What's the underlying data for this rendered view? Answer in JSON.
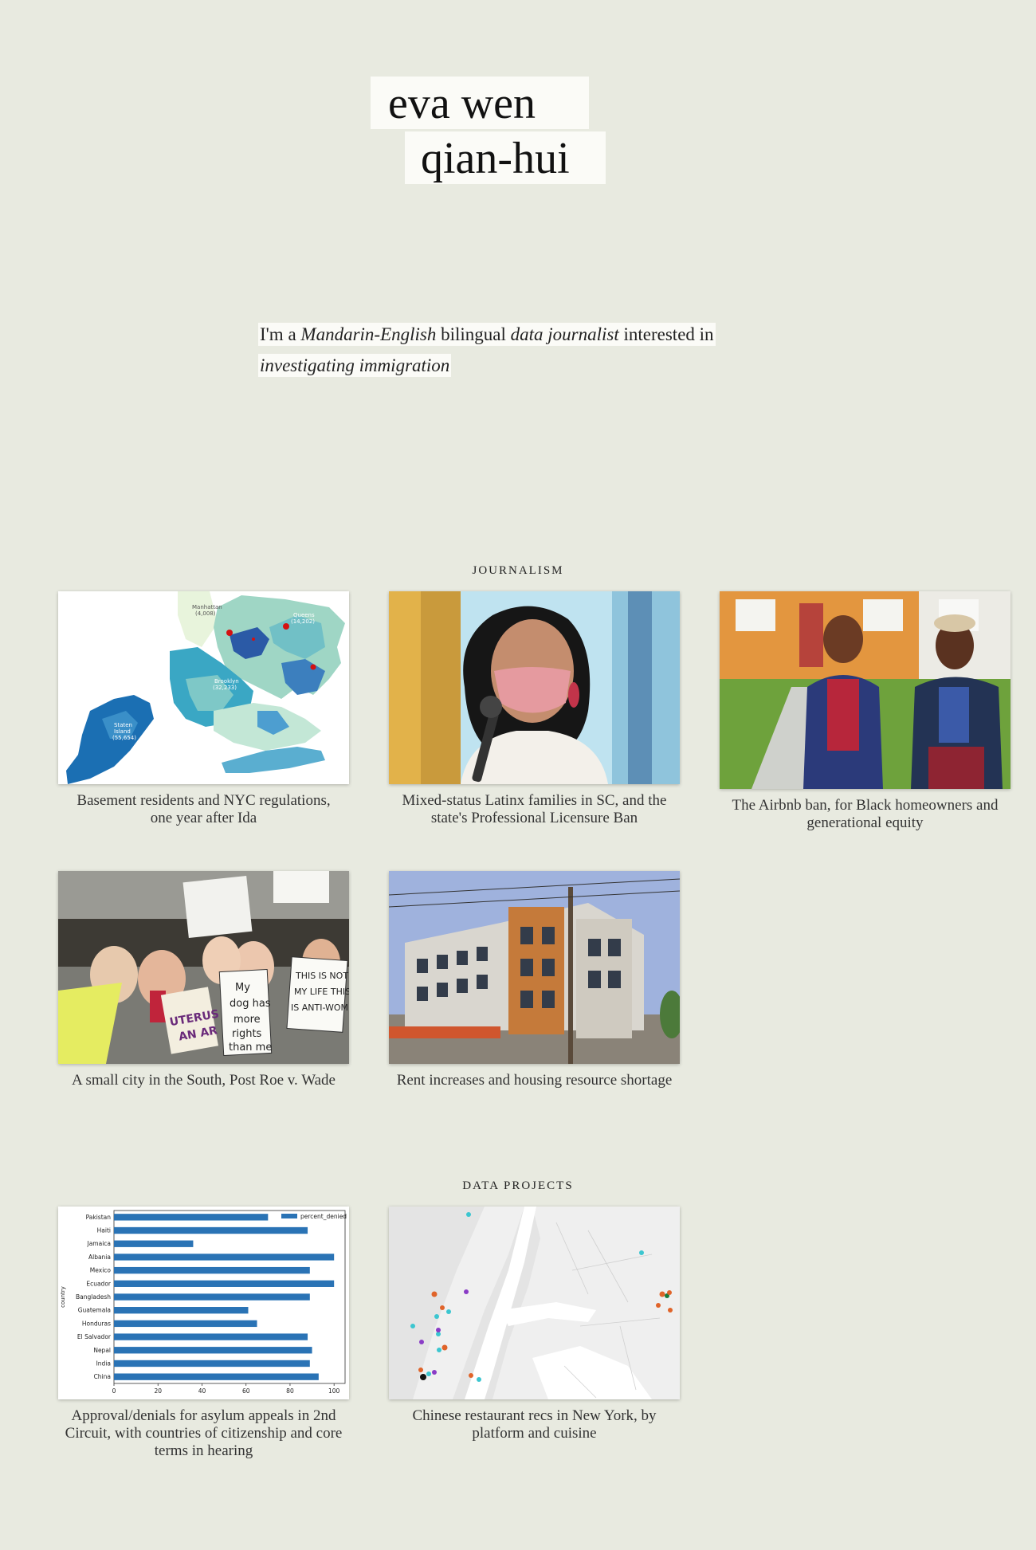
{
  "header": {
    "name_line1": "eva wen",
    "name_line2": "qian-hui"
  },
  "bio": {
    "part1": "I'm a ",
    "em1": "Mandarin-English",
    "part2": " bilingual ",
    "em2": "data journalist",
    "part3": " interested in",
    "em3": "investigating immigration"
  },
  "journalism": {
    "title": "JOURNALISM",
    "items": [
      {
        "caption": "Basement residents and NYC regulations, one year after Ida"
      },
      {
        "caption": "Mixed-status Latinx families in SC, and the state's Professional Licensure Ban"
      },
      {
        "caption": "The Airbnb ban, for Black homeowners and generational equity"
      },
      {
        "caption": "A small city in the South, Post Roe v. Wade"
      },
      {
        "caption": "Rent increases and housing resource shortage"
      }
    ]
  },
  "data_projects": {
    "title": "DATA PROJECTS",
    "items": [
      {
        "caption": "Approval/denials for asylum appeals in 2nd Circuit, with countries of citizenship and core terms in hearing"
      },
      {
        "caption": "Chinese restaurant recs in New York, by platform and cuisine"
      }
    ]
  },
  "map_labels": {
    "manhattan": "Manhattan",
    "manhattan_count": "(4,008)",
    "queens": "Queens",
    "queens_count": "(14,202)",
    "brooklyn": "Brooklyn",
    "brooklyn_count": "(32,233)",
    "staten": "Staten",
    "island": "Island",
    "staten_count": "(55,654)"
  },
  "sign_text": {
    "s1": "My",
    "s2": "dog has",
    "s3": "more",
    "s4": "rights",
    "s5": "than me",
    "t1": "THIS IS NOT",
    "t2": "MY LIFE THIS",
    "t3": "IS ANTI-WOMEN!",
    "u1": "UTERUS",
    "u2": "AN AR"
  },
  "chart_data": {
    "type": "bar",
    "orientation": "horizontal",
    "categories": [
      "Pakistan",
      "Haiti",
      "Jamaica",
      "Albania",
      "Mexico",
      "Ecuador",
      "Bangladesh",
      "Guatemala",
      "Honduras",
      "El Salvador",
      "Nepal",
      "India",
      "China"
    ],
    "series": [
      {
        "name": "percent_denied",
        "values": [
          70,
          88,
          36,
          100,
          89,
          100,
          89,
          61,
          65,
          88,
          90,
          89,
          93
        ]
      }
    ],
    "ylabel": "country",
    "xlabel": "",
    "xlim": [
      0,
      105
    ],
    "xticks": [
      0,
      20,
      40,
      60,
      80,
      100
    ],
    "legend": "top-right",
    "color": "#2a73b5"
  },
  "colors": {
    "background": "#e8eae0",
    "name_box": "#fbfbf7",
    "bar": "#2a73b5"
  }
}
